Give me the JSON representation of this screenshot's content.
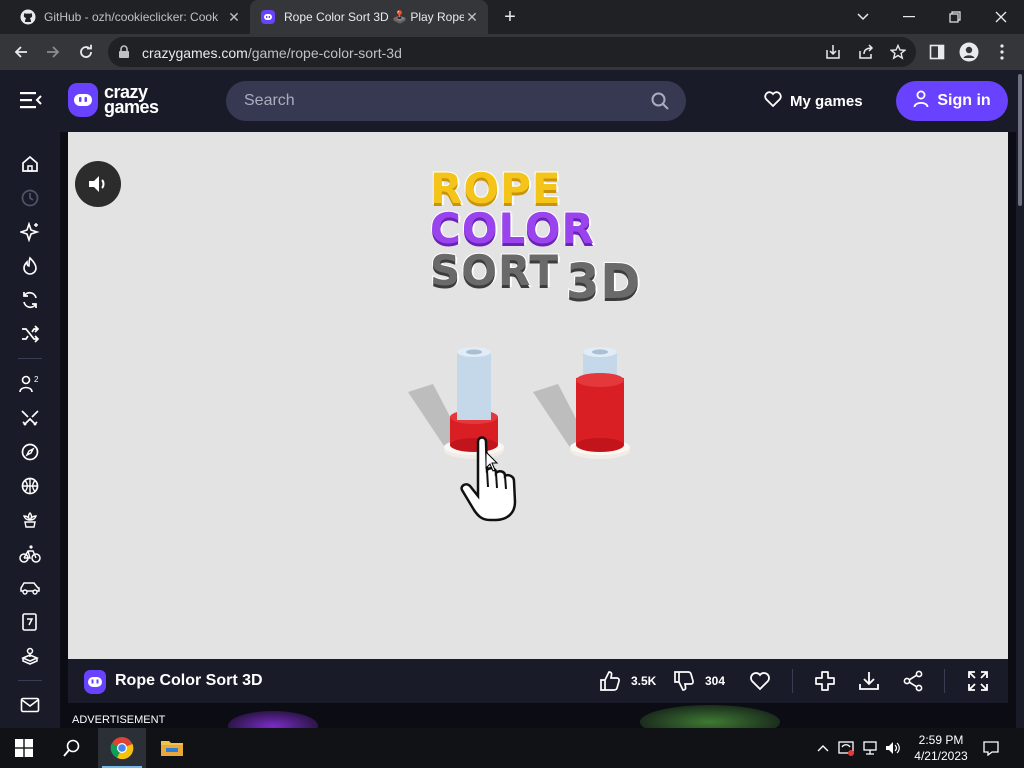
{
  "browser": {
    "tabs": [
      {
        "title": "GitHub - ozh/cookieclicker: Cook",
        "favicon": "github-icon",
        "active": false
      },
      {
        "title": "Rope Color Sort 3D 🕹️ Play Rope",
        "favicon": "crazygames-icon",
        "active": true
      }
    ],
    "new_tab": "+",
    "url_host": "crazygames.com",
    "url_path": "/game/rope-color-sort-3d"
  },
  "site": {
    "logo_line1": "crazy",
    "logo_line2": "games",
    "search_placeholder": "Search",
    "my_games": "My games",
    "sign_in": "Sign in",
    "accent": "#6842ff"
  },
  "sidebar": {
    "icons": [
      "home-icon",
      "recent-icon",
      "new-icon",
      "trending-icon",
      "updated-icon",
      "random-icon",
      "two-player-icon",
      "action-icon",
      "adventure-icon",
      "basketball-icon",
      "beauty-icon",
      "bike-icon",
      "car-icon",
      "card-icon",
      "clicker-icon",
      "mail-icon"
    ]
  },
  "game": {
    "title_art": {
      "line1": "ROPE",
      "line2": "COLOR",
      "line3": "SORT",
      "line4": "3D"
    },
    "title": "Rope Color Sort 3D",
    "likes": "3.5K",
    "dislikes": "304"
  },
  "ad_label": "ADVERTISEMENT",
  "taskbar": {
    "time": "2:59 PM",
    "date": "4/21/2023"
  }
}
